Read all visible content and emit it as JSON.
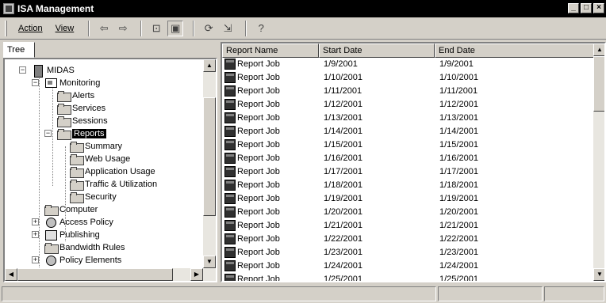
{
  "window": {
    "title": "ISA Management"
  },
  "toolbar": {
    "menu_action": "Action",
    "menu_view": "View"
  },
  "tree": {
    "tab_label": "Tree",
    "items": [
      {
        "label": "MIDAS",
        "icon": "server-icon",
        "expander": "−"
      },
      {
        "label": "Monitoring",
        "icon": "monitor-icon",
        "expander": "−"
      },
      {
        "label": "Alerts",
        "icon": "folder-icon"
      },
      {
        "label": "Services",
        "icon": "folder-icon"
      },
      {
        "label": "Sessions",
        "icon": "folder-icon"
      },
      {
        "label": "Reports",
        "icon": "folder-open-icon",
        "expander": "−",
        "selected": true
      },
      {
        "label": "Summary",
        "icon": "folder-icon"
      },
      {
        "label": "Web Usage",
        "icon": "folder-icon"
      },
      {
        "label": "Application Usage",
        "icon": "folder-icon"
      },
      {
        "label": "Traffic & Utilization",
        "icon": "folder-icon"
      },
      {
        "label": "Security",
        "icon": "folder-icon"
      },
      {
        "label": "Computer",
        "icon": "folder-icon"
      },
      {
        "label": "Access Policy",
        "icon": "policy-icon",
        "expander": "+"
      },
      {
        "label": "Publishing",
        "icon": "publishing-icon",
        "expander": "+"
      },
      {
        "label": "Bandwidth Rules",
        "icon": "folder-icon"
      },
      {
        "label": "Policy Elements",
        "icon": "elements-icon",
        "expander": "+"
      }
    ]
  },
  "list": {
    "columns": [
      "Report Name",
      "Start Date",
      "End Date"
    ],
    "rows": [
      [
        "Report Job",
        "1/9/2001",
        "1/9/2001"
      ],
      [
        "Report Job",
        "1/10/2001",
        "1/10/2001"
      ],
      [
        "Report Job",
        "1/11/2001",
        "1/11/2001"
      ],
      [
        "Report Job",
        "1/12/2001",
        "1/12/2001"
      ],
      [
        "Report Job",
        "1/13/2001",
        "1/13/2001"
      ],
      [
        "Report Job",
        "1/14/2001",
        "1/14/2001"
      ],
      [
        "Report Job",
        "1/15/2001",
        "1/15/2001"
      ],
      [
        "Report Job",
        "1/16/2001",
        "1/16/2001"
      ],
      [
        "Report Job",
        "1/17/2001",
        "1/17/2001"
      ],
      [
        "Report Job",
        "1/18/2001",
        "1/18/2001"
      ],
      [
        "Report Job",
        "1/19/2001",
        "1/19/2001"
      ],
      [
        "Report Job",
        "1/20/2001",
        "1/20/2001"
      ],
      [
        "Report Job",
        "1/21/2001",
        "1/21/2001"
      ],
      [
        "Report Job",
        "1/22/2001",
        "1/22/2001"
      ],
      [
        "Report Job",
        "1/23/2001",
        "1/23/2001"
      ],
      [
        "Report Job",
        "1/24/2001",
        "1/24/2001"
      ],
      [
        "Report Job",
        "1/25/2001",
        "1/25/2001"
      ]
    ]
  }
}
